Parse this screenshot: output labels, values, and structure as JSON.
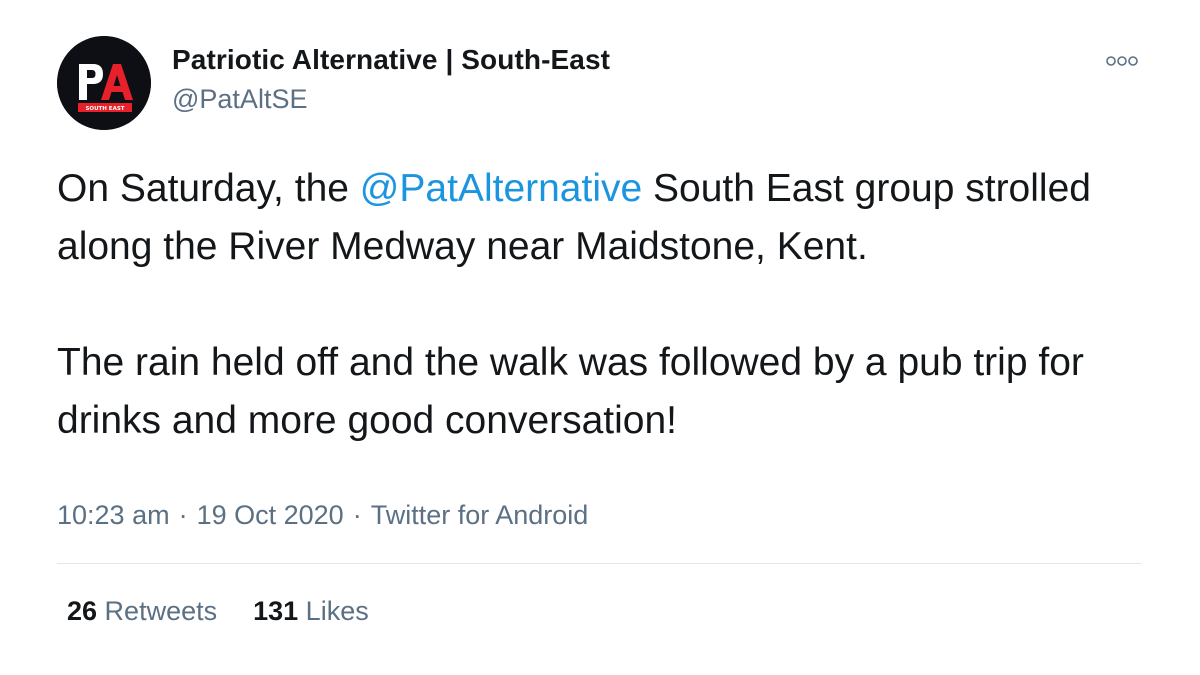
{
  "author": {
    "name": "Patriotic Alternative | South-East",
    "handle": "@PatAltSE",
    "avatar": {
      "logo_text": "PA",
      "sub_text": "SOUTH EAST",
      "colors": {
        "background": "#0d0f14",
        "primary": "#e8202a",
        "text": "#ffffff"
      }
    }
  },
  "more_icon": "more-dots-icon",
  "tweet": {
    "paragraph1": {
      "before": "On Saturday, the ",
      "mention": "@PatAlternative",
      "after": " South East group strolled along the River Medway near Maidstone, Kent."
    },
    "paragraph2": "The rain held off and the walk was followed by a pub trip for drinks and more good conversation!"
  },
  "meta": {
    "time": "10:23 am",
    "separator": "·",
    "date": "19 Oct 2020",
    "source": "Twitter for Android"
  },
  "stats": {
    "retweets_count": "26",
    "retweets_label": " Retweets",
    "likes_count": "131",
    "likes_label": " Likes"
  },
  "colors": {
    "text": "#14171a",
    "secondary": "#5b7083",
    "link": "#1b95e0",
    "divider": "#e1e8ed"
  }
}
